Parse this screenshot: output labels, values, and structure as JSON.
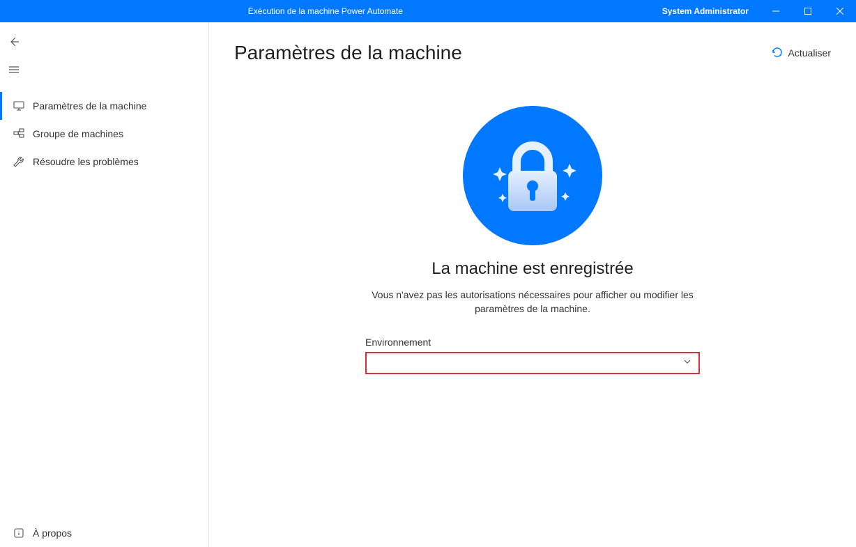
{
  "titlebar": {
    "title": "Exécution de la machine Power Automate",
    "user": "System Administrator"
  },
  "sidebar": {
    "items": [
      {
        "label": "Paramètres de la machine"
      },
      {
        "label": "Groupe de machines"
      },
      {
        "label": "Résoudre les problèmes"
      }
    ],
    "footer": {
      "label": "À propos"
    }
  },
  "main": {
    "page_title": "Paramètres de la machine",
    "refresh_label": "Actualiser",
    "status_heading": "La machine est enregistrée",
    "status_desc": "Vous n'avez pas les autorisations nécessaires pour afficher ou modifier les paramètres de la machine.",
    "env_label": "Environnement",
    "env_value": ""
  }
}
